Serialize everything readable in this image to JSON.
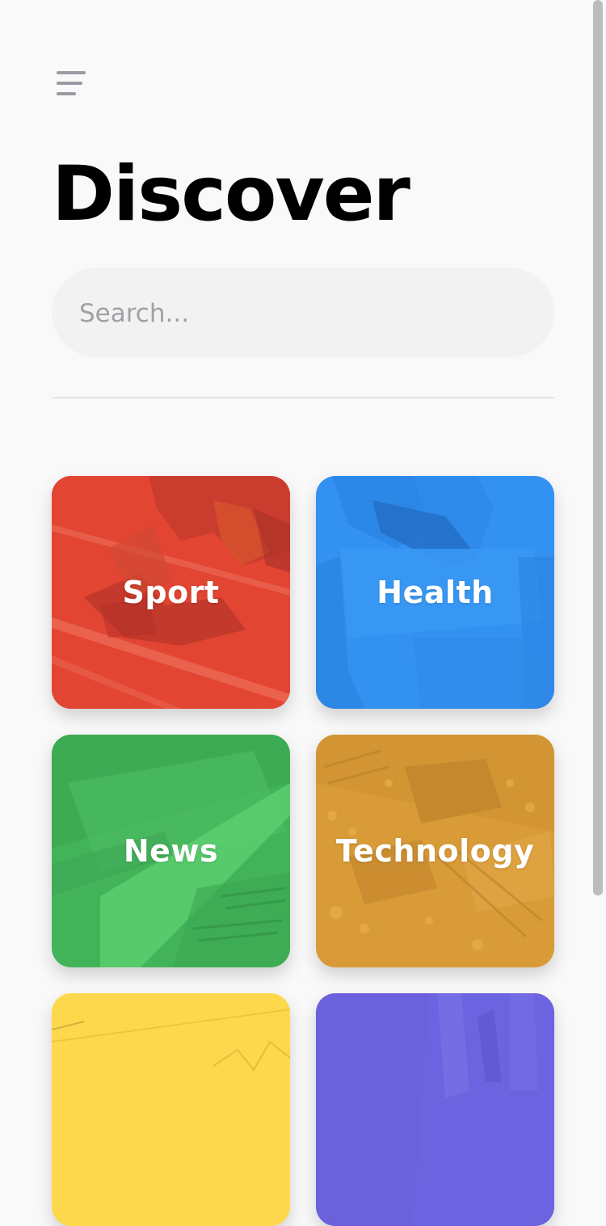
{
  "header": {
    "title": "Discover",
    "menu_icon": "hamburger-menu-icon"
  },
  "search": {
    "placeholder": "Search...",
    "value": ""
  },
  "categories": [
    {
      "label": "Sport",
      "color": "#ec4b38",
      "image": "track-start-photo"
    },
    {
      "label": "Health",
      "color": "#2b8ff0",
      "image": "doctor-photo"
    },
    {
      "label": "News",
      "color": "#43b35a",
      "image": "newspaper-photo"
    },
    {
      "label": "Technology",
      "color": "#d99b38",
      "image": "circuit-board-photo"
    },
    {
      "label": "",
      "color": "#fed84c",
      "image": "chart-paper-photo"
    },
    {
      "label": "",
      "color": "#6b63df",
      "image": "lab-glassware-photo"
    }
  ]
}
